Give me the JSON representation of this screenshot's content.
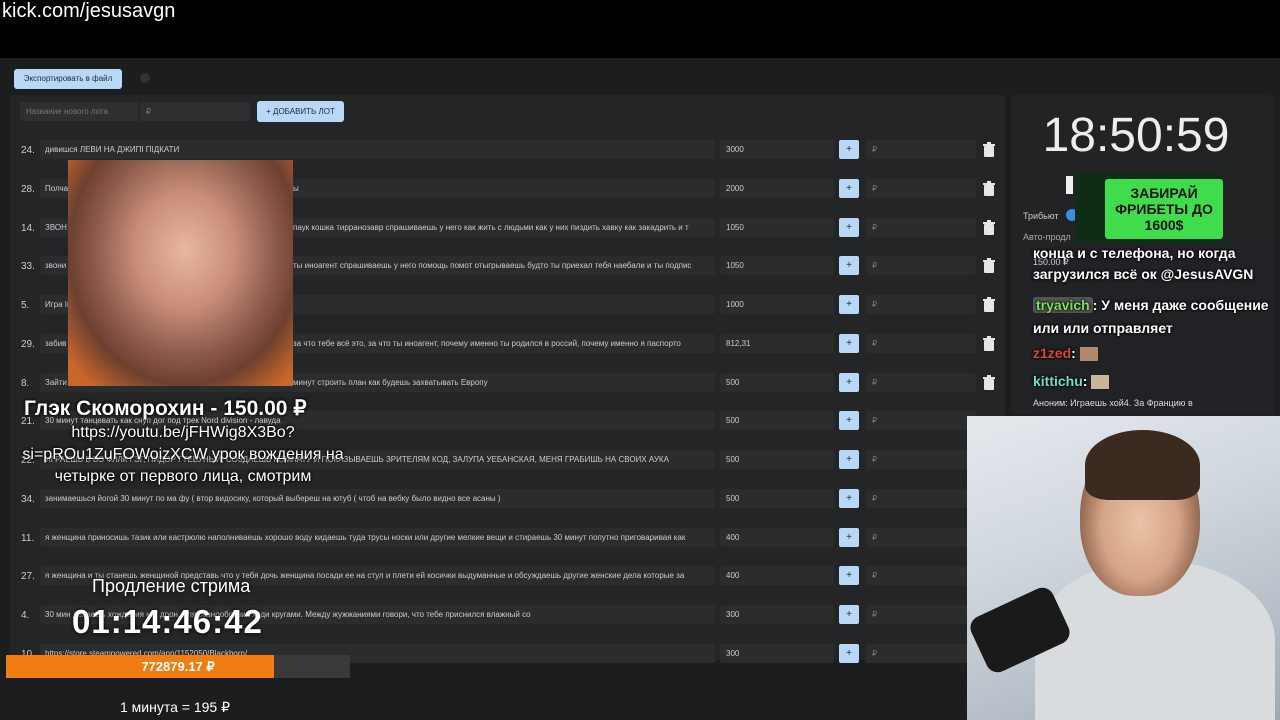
{
  "overlay": {
    "url": "kick.com/jesusavgn",
    "donor_line": "Глэк Скоморохин - 150.00 ₽",
    "donation_message": "https://youtu.be/jFHWig8X3Bo?si=pROu1ZuFOWoizXCW урок вождения на четырке от первого лица, смотрим",
    "extension_label": "Продление стрима",
    "extension_time": "01:14:46:42",
    "total_amount": "772879.17 ₽",
    "progress_fraction": 0.78,
    "rate_text": "1 минута = 195 ₽",
    "ad_text": "ЗАБИРАЙ ФРИБЕТЫ ДО 1600$"
  },
  "toolbar": {
    "export_label": "Экспортировать в файл",
    "new_lot_placeholder": "Название нового лота",
    "price_placeholder": "₽",
    "add_lot_label": "+ ДОБАВИТЬ ЛОТ"
  },
  "lots": [
    {
      "num": "24.",
      "text": "дивишся ЛЕВИ НА ДЖИПІ ПІДКАТИ",
      "amount": "3000"
    },
    {
      "num": "28.",
      "text": "Полча",
      "amount": "2000"
    },
    {
      "num": "14.",
      "text": "ЗВОН",
      "amount": "1050"
    },
    {
      "num": "33.",
      "text": "звони",
      "amount": "1050"
    },
    {
      "num": "5.",
      "text": "Игра In",
      "amount": "1000"
    },
    {
      "num": "29.",
      "text": "забив",
      "amount": "812,31"
    },
    {
      "num": "8.",
      "text": "Зайти",
      "amount": "500"
    },
    {
      "num": "21.",
      "text": "30 минут танцевать как снуп дог под трек Nord division - лавуда",
      "amount": "500"
    },
    {
      "num": "22.",
      "text": "ИГРАЕШЬ В ВО ФЛЛК ГЭГ, ПИДОР ГТЕБУНЫЙ, СОЗДАЕШЬ КОМНАТУ И ПОКАЗЫВАЕШЬ ЗРИТЕЛЯМ КОД, ЗАЛУПА УЕБАНСКАЯ, МЕНЯ ГРАБИШЬ НА СВОИХ АУКА",
      "amount": "500"
    },
    {
      "num": "34.",
      "text": "занимаешься йогой 30 минут по ма фу ( втор видосику, который выбереш на ютуб ( чтоб на вебку было видно все асаны )",
      "amount": "500"
    },
    {
      "num": "11.",
      "text": "я женщина приносишь тазик или кастрюлю наполниваешь хорошо воду кидаешь туда трусы носки или другие мелкие вещи и стираешь 30 минут попутно приговаривая как",
      "amount": "400"
    },
    {
      "num": "27.",
      "text": "я женщина и ты станешь женщиной представь что у тебя дочь женщина посади ее на стул и плети ей косички выдуманные и обсуждаешь другие женские дела которые за",
      "amount": "400"
    },
    {
      "num": "4.",
      "text": "30 мин делаешь хождения как дрон, для разнообразия ходи кругами. Между жужжаниями говори, что тебе приснился влажный со",
      "amount": "300"
    },
    {
      "num": "10.",
      "text": "https://store.steampowered.com/app/1152050/Blackborn/",
      "amount": "300"
    }
  ],
  "lot_fragments": {
    "row3_tail": "паук кошка тирранозавр спрашиваешь у него как жить с людьми как у них пиздить хавку как закадрить и т",
    "row4_tail": "ты иноагент спрашиваешь у него помощь помот отыгрываешь будто ты приехал тебя наебали и ты подпис",
    "row6_tail": "за что тебе всё это, за что ты иноагент, почему именно ты родился в россий, почему именно я паспорто",
    "row7_tail": "минут строить план как будешь захватывать Европу",
    "row2_tail": "ы"
  },
  "side": {
    "clock": "18:50:59",
    "tribute_label": "Трибьют",
    "auto_label": "Авто-продл"
  },
  "chat": [
    {
      "line": "конца и с телефона, но когда"
    },
    {
      "line": "150.00 ₽"
    },
    {
      "line": "загрузился всё ок @JesusAVGN"
    },
    {
      "user": "tryavich",
      "text": ": У меня даже сообщение или или отправляет"
    },
    {
      "user": "z1zed",
      "text": ":"
    },
    {
      "user": "kittichu",
      "text": ":"
    },
    {
      "line": "Аноним: Играешь хой4. За Францию в"
    }
  ],
  "colors": {
    "accent": "#b9d7f6",
    "progress": "#f07c13",
    "ad_green": "#3fdc4c"
  }
}
